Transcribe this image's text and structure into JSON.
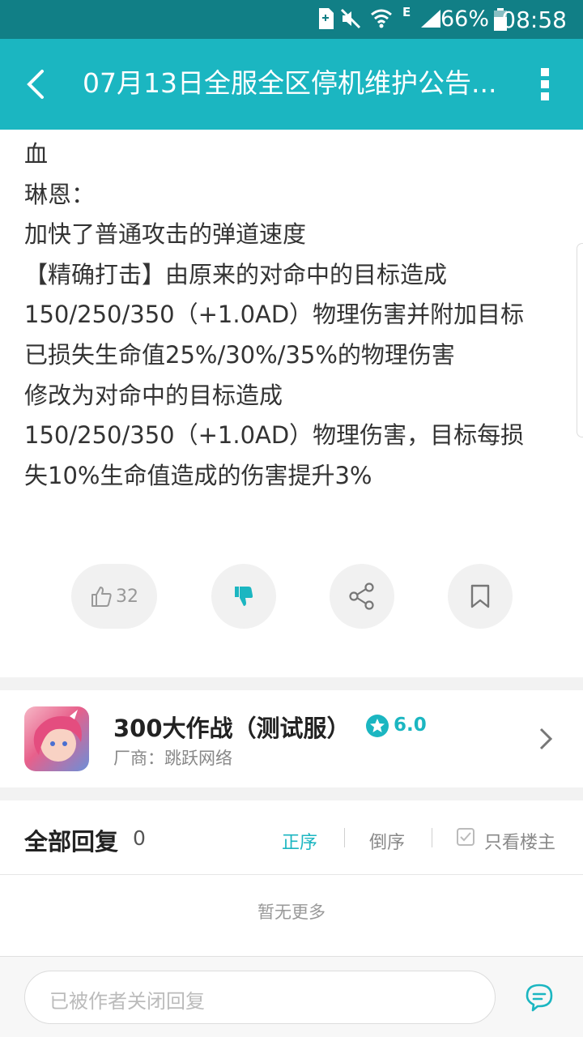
{
  "status_bar": {
    "battery": "66%",
    "time": "08:58",
    "network": "E",
    "icons": [
      "sim-icon",
      "mute-icon",
      "wifi-icon",
      "signal-icon",
      "battery-icon"
    ]
  },
  "app_bar": {
    "title": "07月13日全服全区停机维护公告...",
    "back_icon": "back-arrow-icon",
    "more_icon": "more-vert-icon"
  },
  "article": {
    "lines": [
      "血",
      "琳恩：",
      "加快了普通攻击的弹道速度",
      "【精确打击】由原来的对命中的目标造成",
      "150/250/350（+1.0AD）物理伤害并附加目标",
      "已损失生命值25%/30%/35%的物理伤害",
      "修改为对命中的目标造成",
      "150/250/350（+1.0AD）物理伤害，目标每损",
      "失10%生命值造成的伤害提升3%"
    ]
  },
  "actions": {
    "like_count": "32"
  },
  "game": {
    "name": "300大作战（测试服）",
    "rating": "6.0",
    "vendor": "厂商：跳跃网络"
  },
  "replies": {
    "title": "全部回复",
    "count": "0",
    "sort_asc": "正序",
    "sort_desc": "倒序",
    "only_author": "只看楼主",
    "empty": "暂无更多"
  },
  "bottom": {
    "placeholder": "已被作者关闭回复"
  },
  "colors": {
    "accent": "#1bb6c1",
    "status_bar": "#117f86"
  }
}
